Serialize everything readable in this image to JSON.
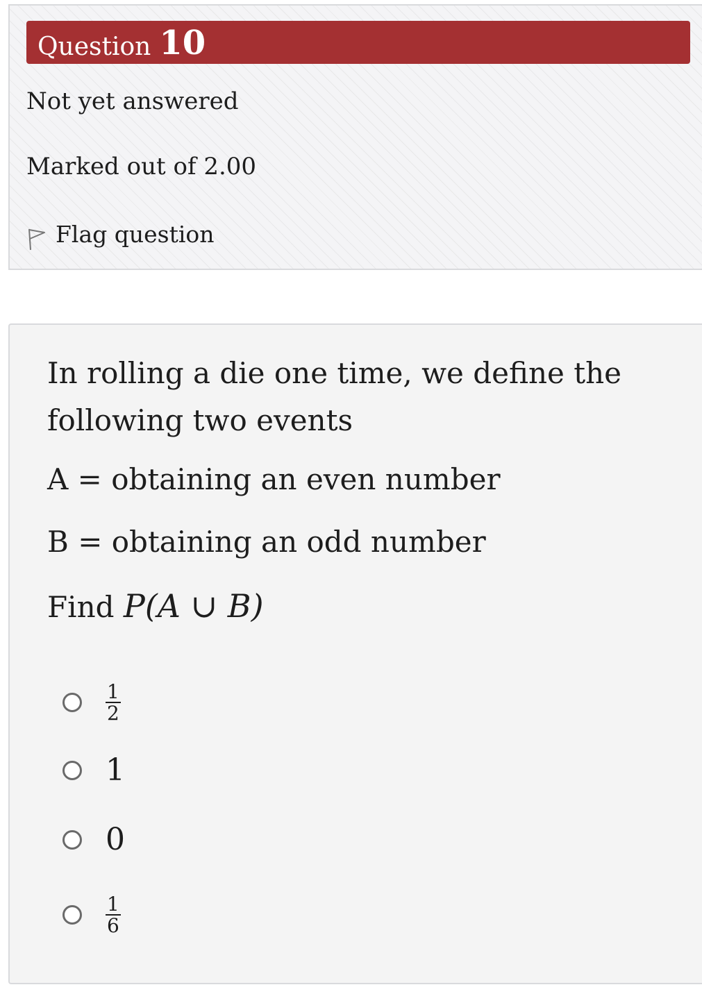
{
  "question": {
    "label": "Question",
    "number": "10",
    "state": "Not yet answered",
    "marked": "Marked out of 2.00",
    "flag_label": "Flag question"
  },
  "content": {
    "text": "In rolling a die one time, we define the following two events",
    "event_a": "A = obtaining an even number",
    "event_b": "B = obtaining an odd number",
    "find_prefix": "Find ",
    "find_expr": "P(A ∪ B)"
  },
  "options": [
    {
      "numerator": "1",
      "denominator": "2"
    },
    {
      "text": "1"
    },
    {
      "text": "0"
    },
    {
      "numerator": "1",
      "denominator": "6"
    }
  ],
  "colors": {
    "header_bg": "#a43032"
  }
}
